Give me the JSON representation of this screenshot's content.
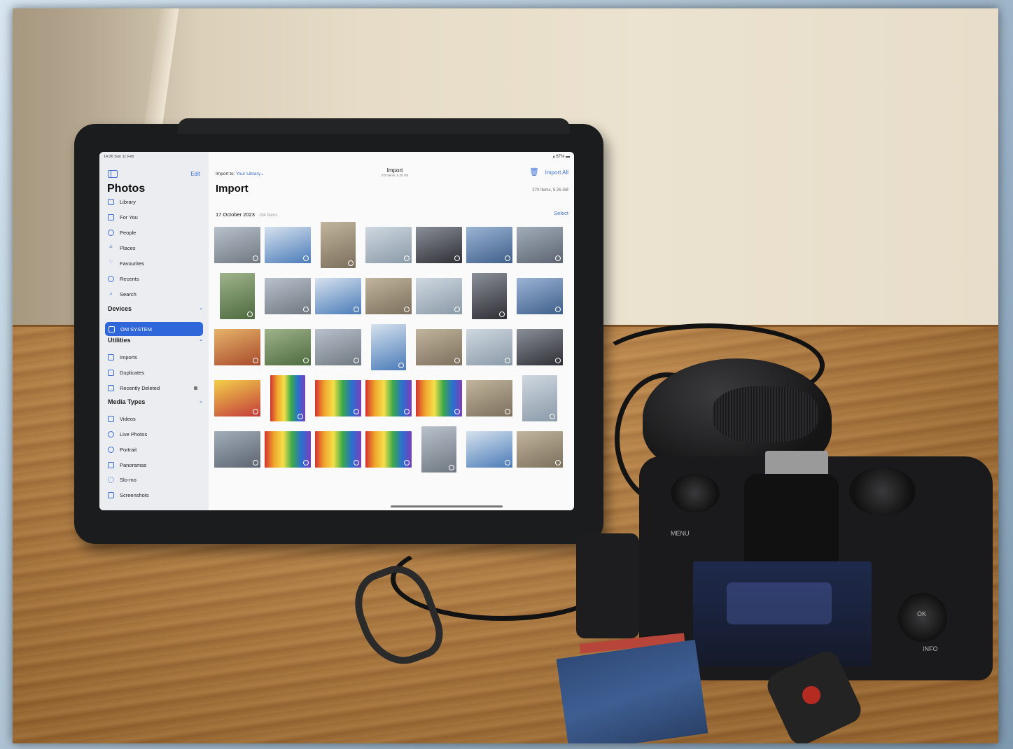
{
  "ipad": {
    "status": {
      "time": "14:26  Sun 11 Feb",
      "battery": "67%"
    },
    "sidebar": {
      "edit_label": "Edit",
      "title": "Photos",
      "items": [
        {
          "label": "Library",
          "icon": "library-icon"
        },
        {
          "label": "For You",
          "icon": "for-you-icon"
        },
        {
          "label": "People",
          "icon": "people-icon"
        },
        {
          "label": "Places",
          "icon": "places-icon"
        },
        {
          "label": "Favourites",
          "icon": "heart-icon"
        },
        {
          "label": "Recents",
          "icon": "clock-icon"
        },
        {
          "label": "Search",
          "icon": "search-icon"
        }
      ],
      "devices_header": "Devices",
      "device_selected": "OM SYSTEM",
      "utilities_header": "Utilities",
      "utilities": [
        {
          "label": "Imports",
          "icon": "imports-icon"
        },
        {
          "label": "Duplicates",
          "icon": "duplicates-icon"
        },
        {
          "label": "Recently Deleted",
          "icon": "trash-icon"
        }
      ],
      "media_header": "Media Types",
      "media": [
        {
          "label": "Videos",
          "icon": "video-icon"
        },
        {
          "label": "Live Photos",
          "icon": "live-photo-icon"
        },
        {
          "label": "Portrait",
          "icon": "portrait-icon"
        },
        {
          "label": "Panoramas",
          "icon": "panorama-icon"
        },
        {
          "label": "Slo-mo",
          "icon": "slomo-icon"
        },
        {
          "label": "Screenshots",
          "icon": "screenshot-icon"
        }
      ]
    },
    "main": {
      "import_to_label": "Import to: ",
      "import_to_value": "Your Library",
      "center_title": "Import",
      "center_subtitle": "270 Items, 5.25 GB",
      "import_all_label": "Import All",
      "title": "Import",
      "count": "270 Items, 5.25 GB",
      "date": "17 October 2023",
      "date_count": "194 Items",
      "select_label": "Select"
    }
  },
  "colors": {
    "accent": "#2f66d9",
    "wall": "#e7ddca",
    "table": "#b87d3f"
  }
}
